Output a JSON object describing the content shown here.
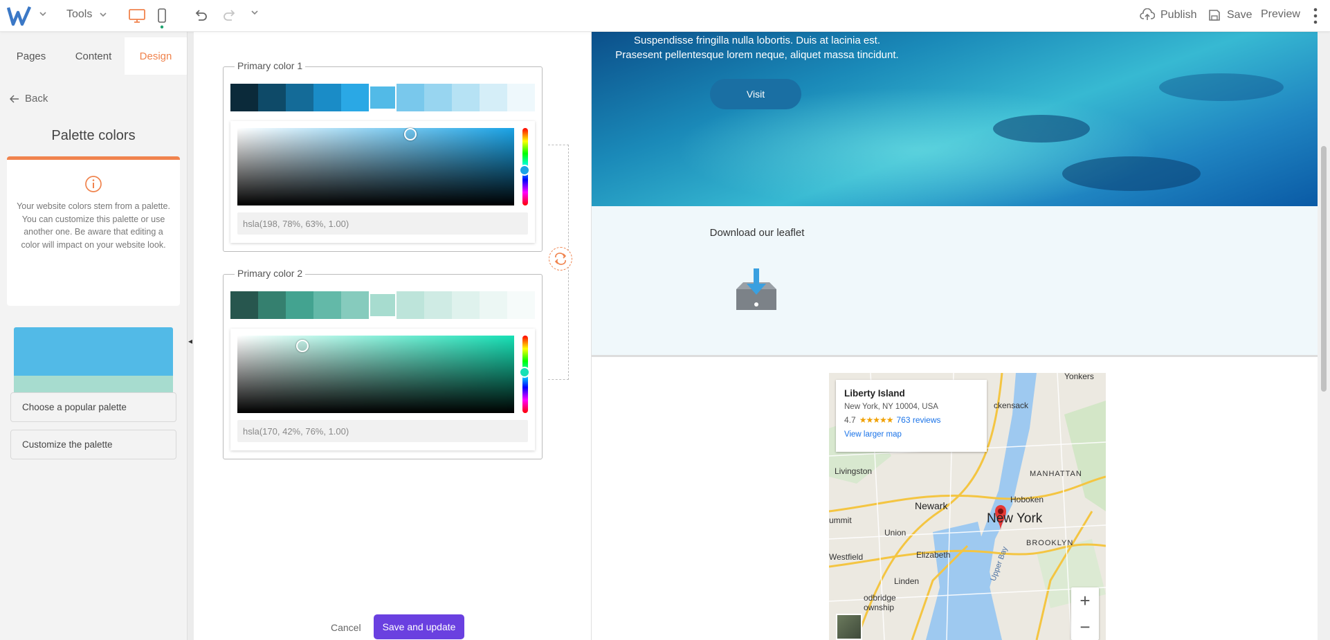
{
  "toolbar": {
    "tools_label": "Tools",
    "publish_label": "Publish",
    "save_label": "Save",
    "preview_label": "Preview",
    "accent": "#f0834d"
  },
  "sidebar": {
    "tabs": [
      {
        "label": "Pages",
        "active": false
      },
      {
        "label": "Content",
        "active": false
      },
      {
        "label": "Design",
        "active": true
      }
    ],
    "back_label": "Back",
    "title": "Palette colors",
    "info_text": "Your website colors stem from a palette. You can customize this palette or use another one. Be aware that editing a color will impact on your website look.",
    "preview_colors": [
      "#52bae7",
      "#a7dccf"
    ],
    "buttons": [
      "Choose a popular palette",
      "Customize the palette"
    ]
  },
  "editor": {
    "primary1": {
      "label": "Primary color 1",
      "value": "hsla(198, 78%, 63%, 1.00)",
      "swatches": [
        "#0b2a3a",
        "#0e4a68",
        "#146b98",
        "#1a8cc7",
        "#2aa8e5",
        "#52bae7",
        "#79c8ec",
        "#98d5f0",
        "#b6e2f4",
        "#d5eef8",
        "#eef8fc"
      ],
      "selected_index": 5,
      "hue_color": "#1aa3e6"
    },
    "primary2": {
      "label": "Primary color 2",
      "value": "hsla(170, 42%, 76%, 1.00)",
      "swatches": [
        "#27564e",
        "#35806f",
        "#43a390",
        "#63b9a8",
        "#86cbbd",
        "#a7dccf",
        "#bde4da",
        "#cfebe4",
        "#dff2ed",
        "#ecf7f4",
        "#f6fbfa"
      ],
      "selected_index": 5,
      "hue_color": "#16e0b5"
    },
    "cancel_label": "Cancel",
    "save_update_label": "Save and update",
    "save_update_color": "#6a40e0"
  },
  "preview": {
    "hero_text_1": "Suspendisse fringilla nulla lobortis. Duis at lacinia est.",
    "hero_text_2": "Prasesent pellentesque lorem neque, aliquet massa tincidunt.",
    "visit_label": "Visit",
    "leaflet_title": "Download our leaflet",
    "map": {
      "place_name": "Liberty Island",
      "address": "New York, NY 10004, USA",
      "rating": "4.7",
      "stars": "★★★★★",
      "reviews": "763 reviews",
      "view_larger": "View larger map",
      "labels": [
        "Yonkers",
        "ckensack",
        "Livingston",
        "MANHATTAN",
        "Hoboken",
        "Newark",
        "New York",
        "BROOKLYN",
        "ummit",
        "Union",
        "Westfield",
        "Elizabeth",
        "Linden",
        "odbridge",
        "ownship",
        "Upper Bay"
      ]
    }
  }
}
